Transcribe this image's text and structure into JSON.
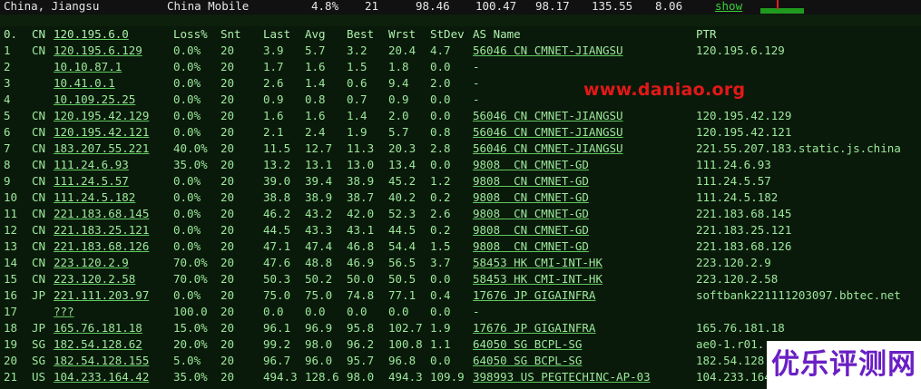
{
  "top_row": {
    "location": "China, Jiangsu",
    "isp": "China Mobile",
    "loss": "4.8%",
    "snt": "21",
    "v1": "98.46",
    "v2": "100.47",
    "v3": "98.17",
    "v4": "135.55",
    "v5": "8.06",
    "show_link": "show"
  },
  "colors": {
    "background": "#0a1a0a",
    "text": "#9de89d",
    "watermark": "#e21818",
    "logo": "#6a1fc4"
  },
  "header": {
    "idx": "0.",
    "cc": "CN",
    "host": "120.195.6.0",
    "loss": "Loss%",
    "snt": "Snt",
    "last": "Last",
    "avg": "Avg",
    "best": "Best",
    "wrst": "Wrst",
    "stdev": "StDev",
    "asname": "AS Name",
    "ptr": "PTR"
  },
  "hops": [
    {
      "idx": "1",
      "cc": "CN",
      "host": "120.195.6.129",
      "loss": "0.0%",
      "snt": "20",
      "last": "3.9",
      "avg": "5.7",
      "best": "3.2",
      "wrst": "20.4",
      "stdev": "4.7",
      "asname": "56046 CN CMNET-JIANGSU",
      "ptr": "120.195.6.129"
    },
    {
      "idx": "2",
      "cc": "",
      "host": "10.10.87.1",
      "loss": "0.0%",
      "snt": "20",
      "last": "1.7",
      "avg": "1.6",
      "best": "1.5",
      "wrst": "1.8",
      "stdev": "0.0",
      "asname": "-",
      "ptr": ""
    },
    {
      "idx": "3",
      "cc": "",
      "host": "10.41.0.1",
      "loss": "0.0%",
      "snt": "20",
      "last": "2.6",
      "avg": "1.4",
      "best": "0.6",
      "wrst": "9.4",
      "stdev": "2.0",
      "asname": "-",
      "ptr": ""
    },
    {
      "idx": "4",
      "cc": "",
      "host": "10.109.25.25",
      "loss": "0.0%",
      "snt": "20",
      "last": "0.9",
      "avg": "0.8",
      "best": "0.7",
      "wrst": "0.9",
      "stdev": "0.0",
      "asname": "-",
      "ptr": ""
    },
    {
      "idx": "5",
      "cc": "CN",
      "host": "120.195.42.129",
      "loss": "0.0%",
      "snt": "20",
      "last": "1.6",
      "avg": "1.6",
      "best": "1.4",
      "wrst": "2.0",
      "stdev": "0.0",
      "asname": "56046 CN CMNET-JIANGSU",
      "ptr": "120.195.42.129"
    },
    {
      "idx": "6",
      "cc": "CN",
      "host": "120.195.42.121",
      "loss": "0.0%",
      "snt": "20",
      "last": "2.1",
      "avg": "2.4",
      "best": "1.9",
      "wrst": "5.7",
      "stdev": "0.8",
      "asname": "56046 CN CMNET-JIANGSU",
      "ptr": "120.195.42.121"
    },
    {
      "idx": "7",
      "cc": "CN",
      "host": "183.207.55.221",
      "loss": "40.0%",
      "snt": "20",
      "last": "11.5",
      "avg": "12.7",
      "best": "11.3",
      "wrst": "20.3",
      "stdev": "2.8",
      "asname": "56046 CN CMNET-JIANGSU",
      "ptr": "221.55.207.183.static.js.china"
    },
    {
      "idx": "8",
      "cc": "CN",
      "host": "111.24.6.93",
      "loss": "35.0%",
      "snt": "20",
      "last": "13.2",
      "avg": "13.1",
      "best": "13.0",
      "wrst": "13.4",
      "stdev": "0.0",
      "asname": "9808  CN CMNET-GD",
      "ptr": "111.24.6.93"
    },
    {
      "idx": "9",
      "cc": "CN",
      "host": "111.24.5.57",
      "loss": "0.0%",
      "snt": "20",
      "last": "39.0",
      "avg": "39.4",
      "best": "38.9",
      "wrst": "45.2",
      "stdev": "1.2",
      "asname": "9808  CN CMNET-GD",
      "ptr": "111.24.5.57"
    },
    {
      "idx": "10",
      "cc": "CN",
      "host": "111.24.5.182",
      "loss": "0.0%",
      "snt": "20",
      "last": "38.8",
      "avg": "38.9",
      "best": "38.7",
      "wrst": "40.2",
      "stdev": "0.2",
      "asname": "9808  CN CMNET-GD",
      "ptr": "111.24.5.182"
    },
    {
      "idx": "11",
      "cc": "CN",
      "host": "221.183.68.145",
      "loss": "0.0%",
      "snt": "20",
      "last": "46.2",
      "avg": "43.2",
      "best": "42.0",
      "wrst": "52.3",
      "stdev": "2.6",
      "asname": "9808  CN CMNET-GD",
      "ptr": "221.183.68.145"
    },
    {
      "idx": "12",
      "cc": "CN",
      "host": "221.183.25.121",
      "loss": "0.0%",
      "snt": "20",
      "last": "44.5",
      "avg": "43.3",
      "best": "43.1",
      "wrst": "44.5",
      "stdev": "0.2",
      "asname": "9808  CN CMNET-GD",
      "ptr": "221.183.25.121"
    },
    {
      "idx": "13",
      "cc": "CN",
      "host": "221.183.68.126",
      "loss": "0.0%",
      "snt": "20",
      "last": "47.1",
      "avg": "47.4",
      "best": "46.8",
      "wrst": "54.4",
      "stdev": "1.5",
      "asname": "9808  CN CMNET-GD",
      "ptr": "221.183.68.126"
    },
    {
      "idx": "14",
      "cc": "CN",
      "host": "223.120.2.9",
      "loss": "70.0%",
      "snt": "20",
      "last": "47.6",
      "avg": "48.8",
      "best": "46.9",
      "wrst": "56.5",
      "stdev": "3.7",
      "asname": "58453 HK CMI-INT-HK",
      "ptr": "223.120.2.9"
    },
    {
      "idx": "15",
      "cc": "CN",
      "host": "223.120.2.58",
      "loss": "70.0%",
      "snt": "20",
      "last": "50.3",
      "avg": "50.2",
      "best": "50.0",
      "wrst": "50.5",
      "stdev": "0.0",
      "asname": "58453 HK CMI-INT-HK",
      "ptr": "223.120.2.58"
    },
    {
      "idx": "16",
      "cc": "JP",
      "host": "221.111.203.97",
      "loss": "0.0%",
      "snt": "20",
      "last": "75.0",
      "avg": "75.0",
      "best": "74.8",
      "wrst": "77.1",
      "stdev": "0.4",
      "asname": "17676 JP GIGAINFRA",
      "ptr": "softbank221111203097.bbtec.net"
    },
    {
      "idx": "17",
      "cc": "",
      "host": "???",
      "loss": "100.0",
      "snt": "20",
      "last": "0.0",
      "avg": "0.0",
      "best": "0.0",
      "wrst": "0.0",
      "stdev": "0.0",
      "asname": "-",
      "ptr": ""
    },
    {
      "idx": "18",
      "cc": "JP",
      "host": "165.76.181.18",
      "loss": "15.0%",
      "snt": "20",
      "last": "96.1",
      "avg": "96.9",
      "best": "95.8",
      "wrst": "102.7",
      "stdev": "1.9",
      "asname": "17676 JP GIGAINFRA",
      "ptr": "165.76.181.18"
    },
    {
      "idx": "19",
      "cc": "SG",
      "host": "182.54.128.62",
      "loss": "20.0%",
      "snt": "20",
      "last": "99.2",
      "avg": "98.0",
      "best": "96.2",
      "wrst": "100.8",
      "stdev": "1.1",
      "asname": "64050 SG BCPL-SG",
      "ptr": "ae0-1.r01."
    },
    {
      "idx": "20",
      "cc": "SG",
      "host": "182.54.128.155",
      "loss": "5.0%",
      "snt": "20",
      "last": "96.7",
      "avg": "96.0",
      "best": "95.7",
      "wrst": "96.8",
      "stdev": "0.0",
      "asname": "64050 SG BCPL-SG",
      "ptr": "182.54.128"
    },
    {
      "idx": "21",
      "cc": "US",
      "host": "104.233.164.42",
      "loss": "35.0%",
      "snt": "20",
      "last": "494.3",
      "avg": "128.6",
      "best": "98.0",
      "wrst": "494.3",
      "stdev": "109.9",
      "asname": "398993 US PEGTECHINC-AP-03",
      "ptr": "104.233.164"
    }
  ],
  "watermark": "www.daniao.org",
  "logo_text": "优乐评测网"
}
